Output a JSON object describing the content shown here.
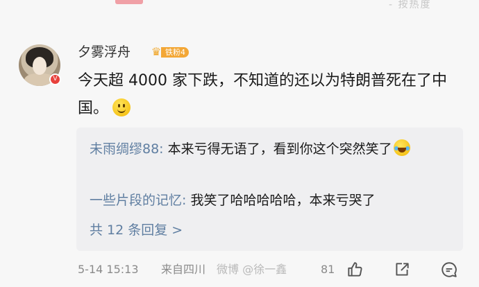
{
  "top_cut": "- 按热度",
  "comment": {
    "username": "夕雾浮舟",
    "fan_badge": "铁粉4",
    "avatar_badge": "V",
    "text": "今天超 4000 家下跌，不知道的还以为特朗普死在了中国。"
  },
  "replies": [
    {
      "name": "未雨绸缪88:",
      "text": " 本来亏得无语了，看到你这个突然笑了"
    },
    {
      "name": "一些片段的记忆:",
      "text": " 我笑了哈哈哈哈哈，本来亏哭了"
    }
  ],
  "more_replies": "共 12 条回复 >",
  "footer": {
    "time": "5-14 15:13",
    "source": "来自四川",
    "watermark": "微博 @徐一鑫",
    "likes": "81"
  },
  "icons": [
    "crown-icon",
    "smiley-emoji",
    "laugh-cry-emoji",
    "like-icon",
    "share-icon",
    "comment-icon"
  ],
  "colors": {
    "link": "#5f7ea1",
    "badge": "#f3a736",
    "vbadge": "#e8413c"
  }
}
